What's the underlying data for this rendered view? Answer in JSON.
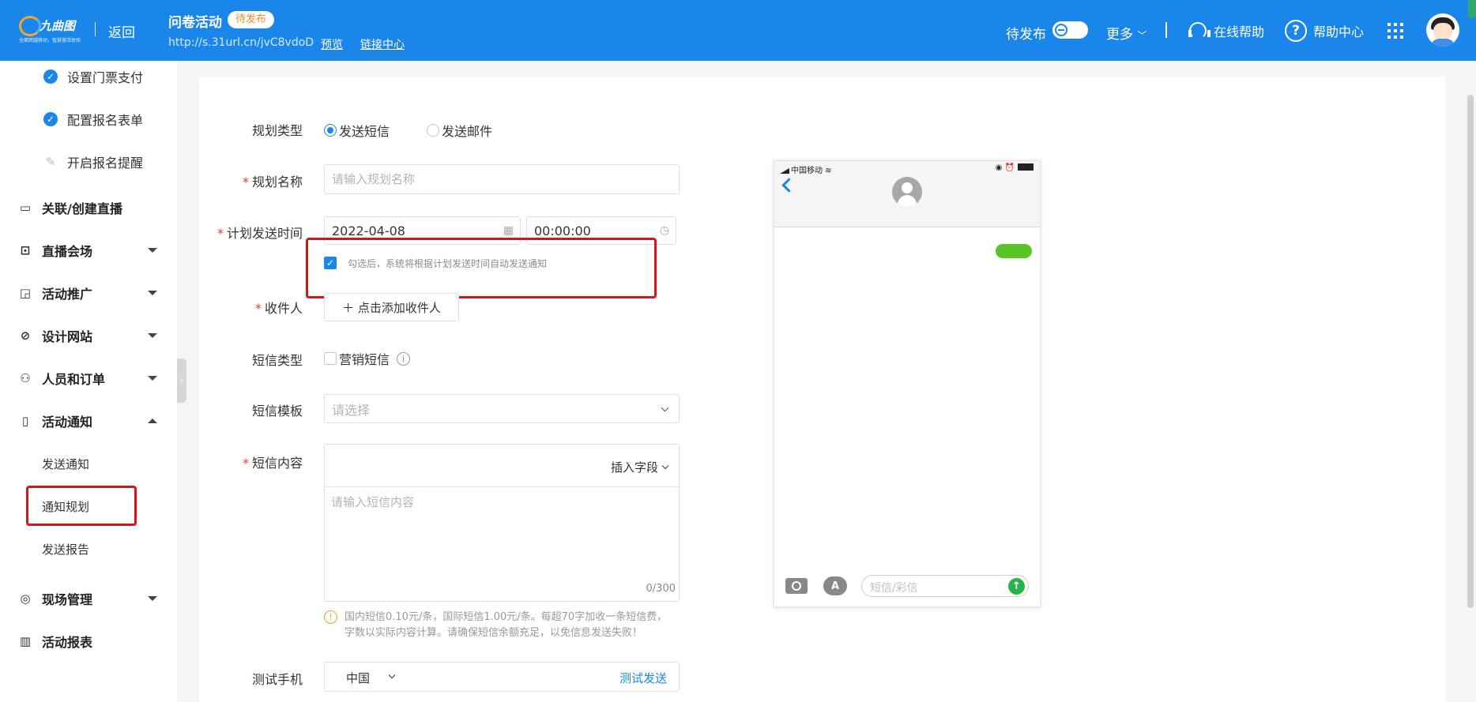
{
  "header": {
    "logo_name": "九曲图",
    "logo_sub": "全面跨越移动，智慧营活体验",
    "back_label": "返回",
    "activity_title": "问卷活动",
    "status_badge": "待发布",
    "short_url": "http://s.31url.cn/jvC8vdoD",
    "preview_link": "预览",
    "link_center": "链接中心",
    "publish_label": "待发布",
    "more_label": "更多",
    "online_help": "在线帮助",
    "help_center": "帮助中心",
    "help_glyph": "?"
  },
  "sidebar": {
    "checked_items": [
      {
        "label": "设置门票支付"
      },
      {
        "label": "配置报名表单"
      }
    ],
    "pending_item": "开启报名提醒",
    "items": [
      {
        "label": "关联/创建直播",
        "icon": "video-icon"
      },
      {
        "label": "直播会场",
        "icon": "venue-icon"
      },
      {
        "label": "活动推广",
        "icon": "cast-icon"
      },
      {
        "label": "设计网站",
        "icon": "design-icon"
      },
      {
        "label": "人员和订单",
        "icon": "people-icon"
      },
      {
        "label": "活动通知",
        "icon": "message-icon"
      },
      {
        "label": "现场管理",
        "icon": "target-icon"
      },
      {
        "label": "活动报表",
        "icon": "chart-icon"
      }
    ],
    "notify_subitems": [
      {
        "label": "发送通知"
      },
      {
        "label": "通知规划"
      },
      {
        "label": "发送报告"
      }
    ]
  },
  "form": {
    "plan_type_label": "规划类型",
    "plan_type_options": [
      "发送短信",
      "发送邮件"
    ],
    "plan_type_selected": "发送短信",
    "plan_name_label": "规划名称",
    "plan_name_placeholder": "请输入规划名称",
    "send_time_label": "计划发送时间",
    "send_date": "2022-04-08",
    "send_clock": "00:00:00",
    "auto_send_checked": true,
    "auto_send_hint": "勾选后，系统将根据计划发送时间自动发送通知",
    "recipient_label": "收件人",
    "add_recipient": "＋  点击添加收件人",
    "sms_type_label": "短信类型",
    "marketing_sms": "营销短信",
    "template_label": "短信模板",
    "template_placeholder": "请选择",
    "content_label": "短信内容",
    "insert_field": "插入字段",
    "content_placeholder": "请输入短信内容",
    "counter": "0/300",
    "fee_notice": "国内短信0.10元/条，国际短信1.00元/条。每超70字加收一条短信费，字数以实际内容计算。请确保短信余额充足，以免信息发送失败！",
    "test_phone_label": "测试手机",
    "country": "中国",
    "test_send": "测试发送",
    "required_mark": "*"
  },
  "phone_preview": {
    "carrier": "中国移动",
    "status_icons": "◉ ⏰",
    "sms_placeholder": "短信/彩信",
    "appstore_glyph": "A",
    "send_glyph": "↑"
  },
  "colors": {
    "primary": "#1b86ea",
    "highlight": "#e0101a",
    "bubble": "#5ac427"
  }
}
